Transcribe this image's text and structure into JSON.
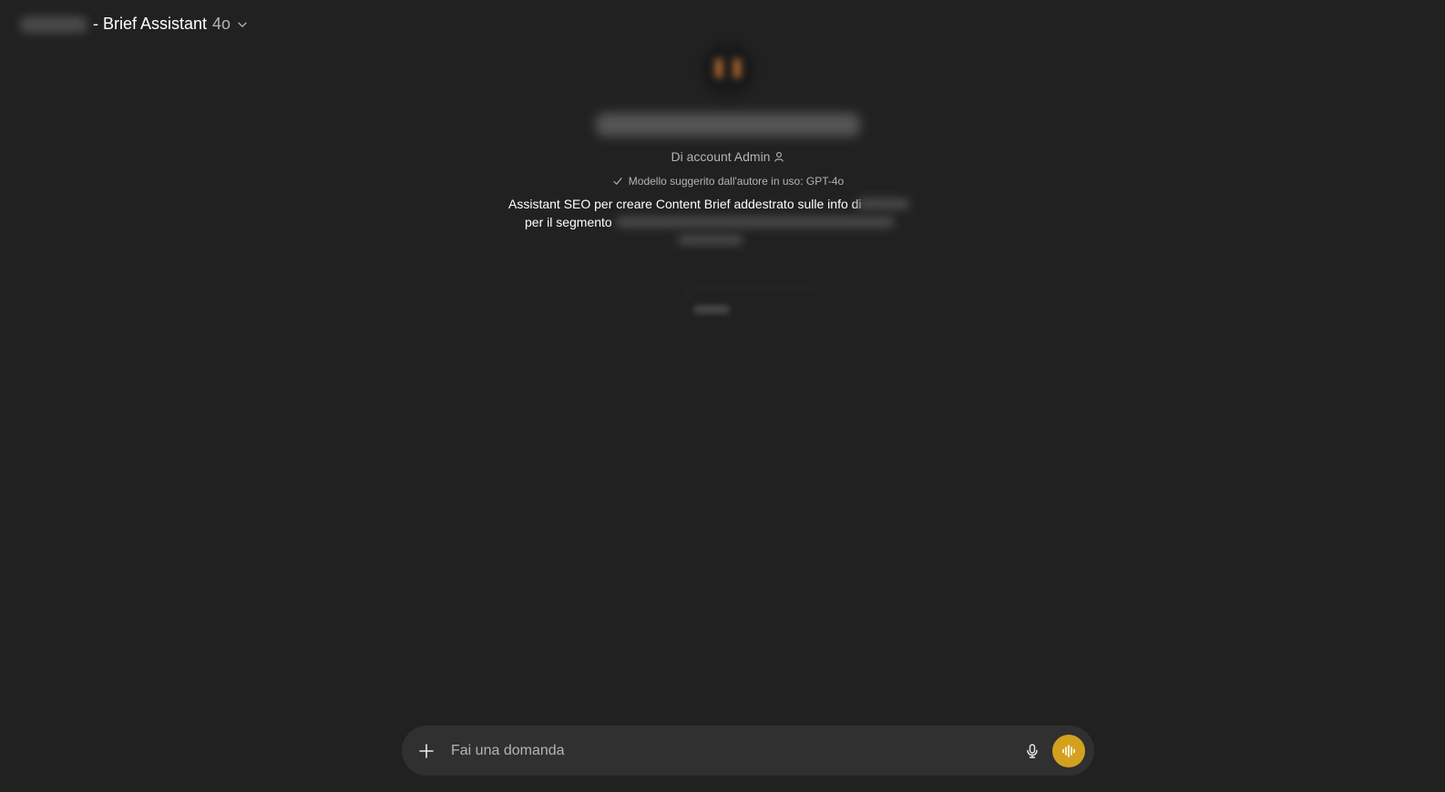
{
  "header": {
    "title": "- Brief Assistant",
    "model_version": "4o"
  },
  "gpt": {
    "author": "Di account Admin",
    "model_note": "Modello suggerito dall'autore in uso: GPT-4o",
    "description_line1": "Assistant SEO per creare Content Brief addestrato sulle info di",
    "description_line2": "per il segmento"
  },
  "composer": {
    "placeholder": "Fai una domanda"
  },
  "colors": {
    "background": "#212121",
    "composer": "#303030",
    "voice_button": "#d4a11e"
  },
  "icons": {
    "header": "chevron-down-icon",
    "author": "user-icon",
    "model_note": "check-icon",
    "composer_left": "plus-icon",
    "mic": "microphone-icon",
    "voice": "voice-waveform-icon"
  }
}
